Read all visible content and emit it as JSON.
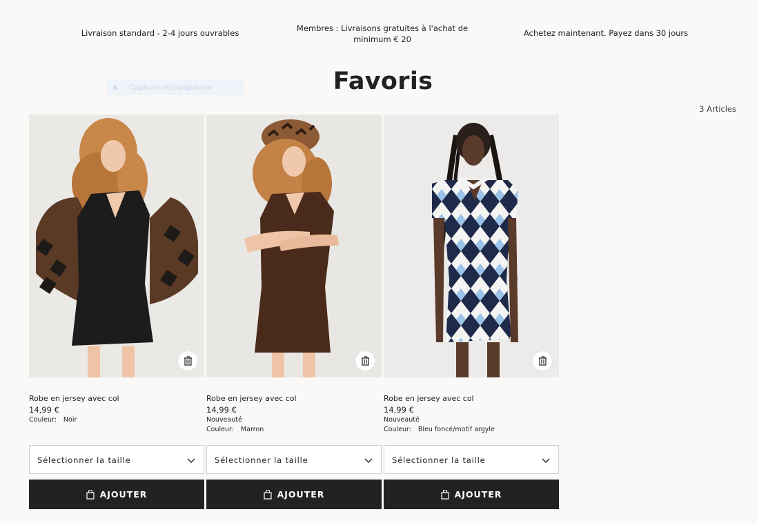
{
  "promos": [
    "Livraison standard - 2-4 jours ouvrables",
    "Membres : Livraisons gratuites à l'achat de minimum € 20",
    "Achetez maintenant. Payez dans 30 jours"
  ],
  "page": {
    "title": "Favoris",
    "count": "3 Articles",
    "capture_label": "Capture rectangulaire"
  },
  "products": [
    {
      "name": "Robe en jersey avec col",
      "price": "14,99 €",
      "tag": "",
      "color_label": "Couleur:",
      "color": "Noir",
      "size_placeholder": "Sélectionner la taille",
      "add_label": "AJOUTER"
    },
    {
      "name": "Robe en jersey avec col",
      "price": "14,99 €",
      "tag": "Nouveauté",
      "color_label": "Couleur:",
      "color": "Marron",
      "size_placeholder": "Sélectionner la taille",
      "add_label": "AJOUTER"
    },
    {
      "name": "Robe en jersey avec col",
      "price": "14,99 €",
      "tag": "Nouveauté",
      "color_label": "Couleur:",
      "color": "Bleu foncé/motif argyle",
      "size_placeholder": "Sélectionner la taille",
      "add_label": "AJOUTER"
    }
  ],
  "icons": [
    "trash-icon",
    "chevron-down-icon",
    "shopping-bag-icon"
  ]
}
